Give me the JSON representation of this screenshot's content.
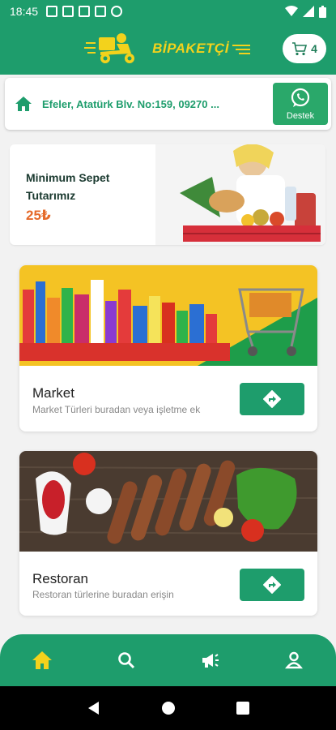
{
  "status_bar": {
    "time": "18:45",
    "icons": [
      "photo-icon",
      "photo-icon",
      "photo-icon",
      "photo-icon",
      "dnd-icon",
      "wifi-icon",
      "signal-icon",
      "battery-icon"
    ]
  },
  "header": {
    "brand": "BİPAKETÇİ",
    "cart_count": "4"
  },
  "address_bar": {
    "address": "Efeler, Atatürk Blv. No:159, 09270 ...",
    "support_label": "Destek"
  },
  "promo": {
    "title": "Minimum Sepet Tutarımız",
    "amount": "25₺"
  },
  "categories": [
    {
      "title": "Market",
      "description": "Market Türleri buradan veya işletme ek"
    },
    {
      "title": "Restoran",
      "description": "Restoran türlerine buradan erişin"
    }
  ],
  "bottom_nav": [
    "home-icon",
    "search-icon",
    "megaphone-icon",
    "profile-icon"
  ],
  "colors": {
    "primary": "#1e9d6c",
    "accent": "#f3d21c",
    "price": "#e56a2a",
    "whatsapp": "#2aa86a"
  }
}
